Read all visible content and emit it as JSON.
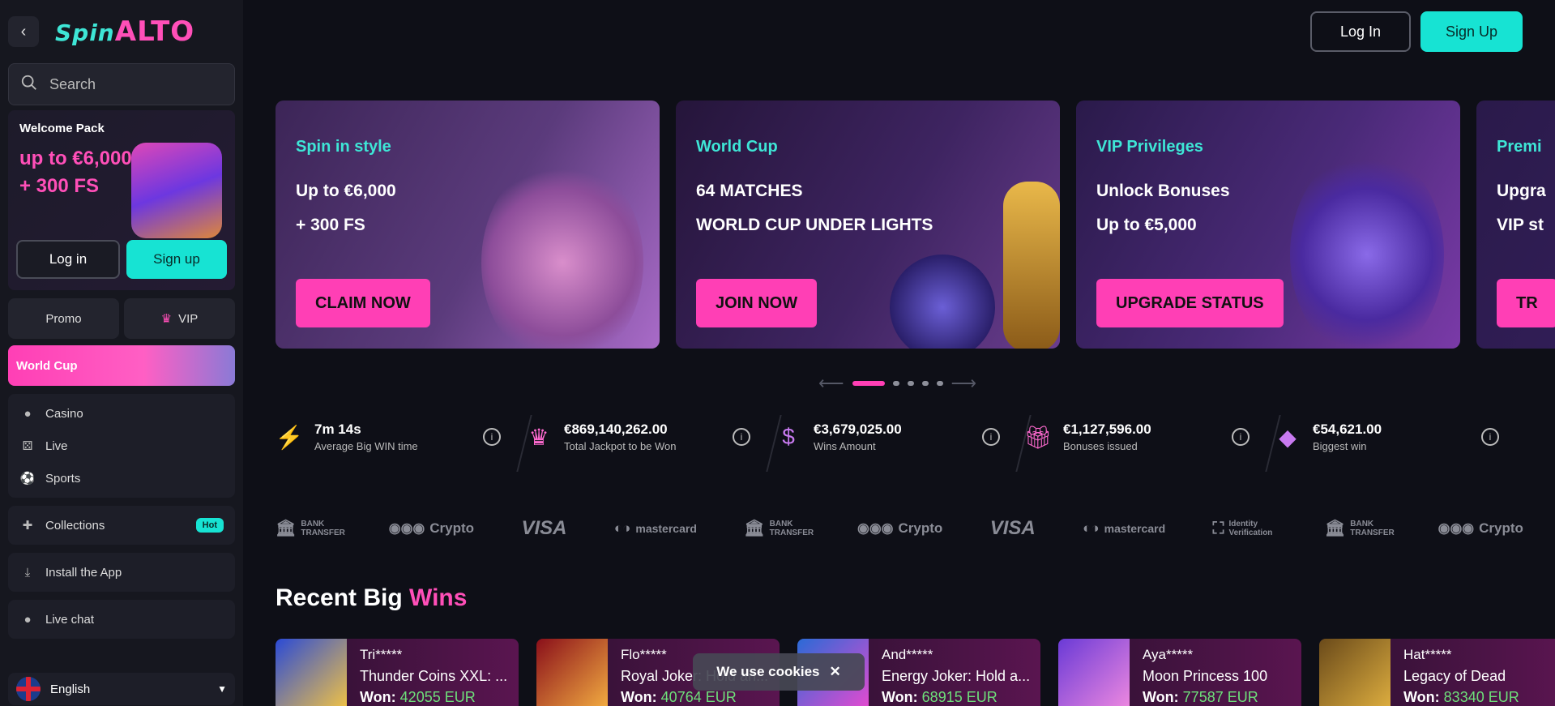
{
  "sidebar": {
    "logo_prefix": "Spin",
    "logo_main": "ALTO",
    "search_placeholder": "Search",
    "welcome": {
      "title": "Welcome Pack",
      "amount_line1": "up to €6,000",
      "amount_line2": "+ 300 FS",
      "login": "Log in",
      "signup": "Sign up"
    },
    "promo": "Promo",
    "vip": "VIP",
    "world_cup": "World Cup",
    "nav": [
      "Casino",
      "Live",
      "Sports"
    ],
    "collections": "Collections",
    "hot_badge": "Hot",
    "install": "Install the App",
    "live_chat": "Live chat",
    "language": "English"
  },
  "header": {
    "login": "Log In",
    "signup": "Sign Up"
  },
  "banners": [
    {
      "kicker": "Spin in style",
      "line1": "Up to €6,000",
      "line2": "+ 300 FS",
      "cta": "CLAIM NOW"
    },
    {
      "kicker": "World Cup",
      "line1": "64 MATCHES",
      "line2": "WORLD CUP UNDER LIGHTS",
      "cta": "JOIN NOW"
    },
    {
      "kicker": "VIP Privileges",
      "line1": "Unlock Bonuses",
      "line2": "Up to €5,000",
      "cta": "UPGRADE STATUS"
    },
    {
      "kicker": "Premi",
      "line1": "Upgra",
      "line2": "VIP st",
      "cta": "TR"
    }
  ],
  "stats": [
    {
      "value": "7m 14s",
      "label": "Average Big WIN time",
      "icon": "lightning-icon"
    },
    {
      "value": "€869,140,262.00",
      "label": "Total Jackpot to be Won",
      "icon": "crown-icon"
    },
    {
      "value": "€3,679,025.00",
      "label": "Wins Amount",
      "icon": "money-bag-icon"
    },
    {
      "value": "€1,127,596.00",
      "label": "Bonuses issued",
      "icon": "gift-icon"
    },
    {
      "value": "€54,621.00",
      "label": "Biggest win",
      "icon": "diamond-icon"
    }
  ],
  "payments": [
    "BANK TRANSFER",
    "Crypto",
    "VISA",
    "mastercard",
    "BANK TRANSFER",
    "Crypto",
    "VISA",
    "mastercard",
    "Identity Verification",
    "BANK TRANSFER",
    "Crypto"
  ],
  "recent": {
    "title_a": "Recent Big ",
    "title_b": "Wins"
  },
  "wins": [
    {
      "user": "Tri*****",
      "game": "Thunder Coins XXL: ...",
      "won_label": "Won:",
      "amount": "42055 EUR"
    },
    {
      "user": "Flo*****",
      "game": "Royal Joker: Hold an...",
      "won_label": "Won:",
      "amount": "40764 EUR"
    },
    {
      "user": "And*****",
      "game": "Energy Joker: Hold a...",
      "won_label": "Won:",
      "amount": "68915 EUR"
    },
    {
      "user": "Aya*****",
      "game": "Moon Princess 100",
      "won_label": "Won:",
      "amount": "77587 EUR"
    },
    {
      "user": "Hat*****",
      "game": "Legacy of Dead",
      "won_label": "Won:",
      "amount": "83340 EUR"
    }
  ],
  "cookie": "We use cookies"
}
